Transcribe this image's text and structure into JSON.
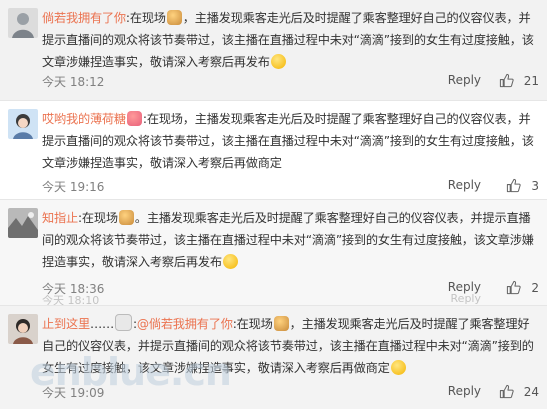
{
  "comments": [
    {
      "user": "倘若我拥有了你",
      "sep": ":",
      "part1": "在现场",
      "part2": "，主播发现乘客走光后及时提醒了乘客整理好自己的仪容仪表，并提示直播间的观众将该节奏带过，该主播在直播过程中未对“滴滴”接到的女生有过度接触，该文章涉嫌捏造事实，敬请深入考察后再发布",
      "time": "今天 18:12",
      "reply": "Reply",
      "likes": "21"
    },
    {
      "user": "哎哟我的薄荷糖",
      "sep": ":",
      "part1": "在现场，",
      "part2": "主播发现乘客走光后及时提醒了乘客整理好自己的仪容仪表，并提示直播间的观众将该节奏带过，该主播在直播过程中未对“滴滴”接到的女生有过度接触，该文章涉嫌捏造事实，敬请深入考察后再做商定",
      "time": "今天 19:16",
      "reply": "Reply",
      "likes": "3"
    },
    {
      "user": "知指止",
      "sep": ":",
      "part1": "在现场",
      "part2": "。主播发现乘客走光后及时提醒了乘客整理好自己的仪容仪表，并提示直播间的观众将该节奏带过，该主播在直播过程中未对“滴滴”接到的女生有过度接触，该文章涉嫌捏造事实，敬请深入考察后再发布",
      "time": "今天 18:36",
      "faded_time": "今天 18:10",
      "reply": "Reply",
      "faded_reply": "Reply",
      "likes": "2"
    },
    {
      "user": "止到这里",
      "user_suffix": "……",
      "mention": "@倘若我拥有了你",
      "sep": ":",
      "part1": "在现场",
      "part2": "，主播发现乘客走光后及时提醒了乘客整理好自己的仪容仪表，并提示直播间的观众将该节奏带过，该主播在直播过程中未对“滴滴”接到的女生有过度接触，该文章涉嫌捏造事实，敬请深入考察后再做商定",
      "time": "今天 19:09",
      "reply": "Reply",
      "likes": "24"
    }
  ],
  "watermark": "enblue.cn",
  "colors": {
    "username": "#eb7350",
    "meta": "#808080"
  },
  "icons": {
    "like": "thumbs-up-icon",
    "emoji_face": "smile-emoji",
    "emoji_person": "person-emoji"
  }
}
